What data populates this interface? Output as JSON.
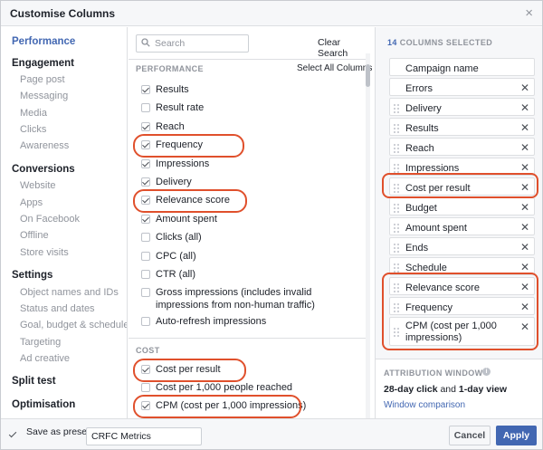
{
  "dialog": {
    "title": "Customise Columns",
    "close_glyph": "×"
  },
  "nav": {
    "items": [
      {
        "label": "Performance",
        "type": "active"
      },
      {
        "label": "Engagement",
        "type": "section"
      },
      {
        "label": "Page post",
        "type": "sub"
      },
      {
        "label": "Messaging",
        "type": "sub"
      },
      {
        "label": "Media",
        "type": "sub"
      },
      {
        "label": "Clicks",
        "type": "sub"
      },
      {
        "label": "Awareness",
        "type": "sub"
      },
      {
        "label": "Conversions",
        "type": "section"
      },
      {
        "label": "Website",
        "type": "sub"
      },
      {
        "label": "Apps",
        "type": "sub"
      },
      {
        "label": "On Facebook",
        "type": "sub"
      },
      {
        "label": "Offline",
        "type": "sub"
      },
      {
        "label": "Store visits",
        "type": "sub"
      },
      {
        "label": "Settings",
        "type": "section"
      },
      {
        "label": "Object names and IDs",
        "type": "sub"
      },
      {
        "label": "Status and dates",
        "type": "sub"
      },
      {
        "label": "Goal, budget & schedule",
        "type": "sub"
      },
      {
        "label": "Targeting",
        "type": "sub"
      },
      {
        "label": "Ad creative",
        "type": "sub"
      },
      {
        "label": "Split test",
        "type": "section"
      },
      {
        "label": "Optimisation",
        "type": "section"
      }
    ]
  },
  "search": {
    "placeholder": "Search",
    "value": "",
    "clear_label": "Clear Search"
  },
  "performance": {
    "heading": "PERFORMANCE",
    "select_all_label": "Select All Columns",
    "options": [
      {
        "label": "Results",
        "checked": true
      },
      {
        "label": "Result rate",
        "checked": false
      },
      {
        "label": "Reach",
        "checked": true
      },
      {
        "label": "Frequency",
        "checked": true,
        "highlighted": true
      },
      {
        "label": "Impressions",
        "checked": true
      },
      {
        "label": "Delivery",
        "checked": true
      },
      {
        "label": "Relevance score",
        "checked": true,
        "highlighted": true
      },
      {
        "label": "Amount spent",
        "checked": true
      },
      {
        "label": "Clicks (all)",
        "checked": false
      },
      {
        "label": "CPC (all)",
        "checked": false
      },
      {
        "label": "CTR (all)",
        "checked": false
      },
      {
        "label": "Gross impressions (includes invalid",
        "label2": "impressions from non-human traffic)",
        "checked": false
      },
      {
        "label": "Auto-refresh impressions",
        "checked": false
      }
    ]
  },
  "cost": {
    "heading": "COST",
    "options": [
      {
        "label": "Cost per result",
        "checked": true,
        "highlighted": true
      },
      {
        "label": "Cost per 1,000 people reached",
        "checked": false
      },
      {
        "label": "CPM (cost per 1,000 impressions)",
        "checked": true,
        "highlighted": true
      }
    ]
  },
  "selected": {
    "count": "14",
    "heading_suffix": "COLUMNS SELECTED",
    "items": [
      {
        "label": "Campaign name",
        "removable": false
      },
      {
        "label": "Errors",
        "removable": true
      },
      {
        "label": "Delivery",
        "removable": true
      },
      {
        "label": "Results",
        "removable": true
      },
      {
        "label": "Reach",
        "removable": true
      },
      {
        "label": "Impressions",
        "removable": true
      },
      {
        "label": "Cost per result",
        "removable": true,
        "highlighted": true
      },
      {
        "label": "Budget",
        "removable": true
      },
      {
        "label": "Amount spent",
        "removable": true
      },
      {
        "label": "Ends",
        "removable": true
      },
      {
        "label": "Schedule",
        "removable": true
      },
      {
        "label": "Relevance score",
        "removable": true,
        "highlighted": true
      },
      {
        "label": "Frequency",
        "removable": true,
        "highlighted": true
      },
      {
        "label": "CPM (cost per 1,000",
        "label2": "impressions)",
        "removable": true,
        "highlighted": true
      }
    ],
    "remove_glyph": "✕"
  },
  "attribution": {
    "heading": "ATTRIBUTION WINDOW",
    "info_glyph": "i",
    "window_click": "28-day click",
    "window_and": " and ",
    "window_view": "1-day view",
    "comparison_link": "Window comparison"
  },
  "footer": {
    "save_preset_label": "Save as preset",
    "preset_value": "CRFC Metrics",
    "save_preset_checked": true,
    "cancel_label": "Cancel",
    "apply_label": "Apply"
  },
  "colors": {
    "accent": "#4267b2",
    "annotation": "#e0502c"
  }
}
